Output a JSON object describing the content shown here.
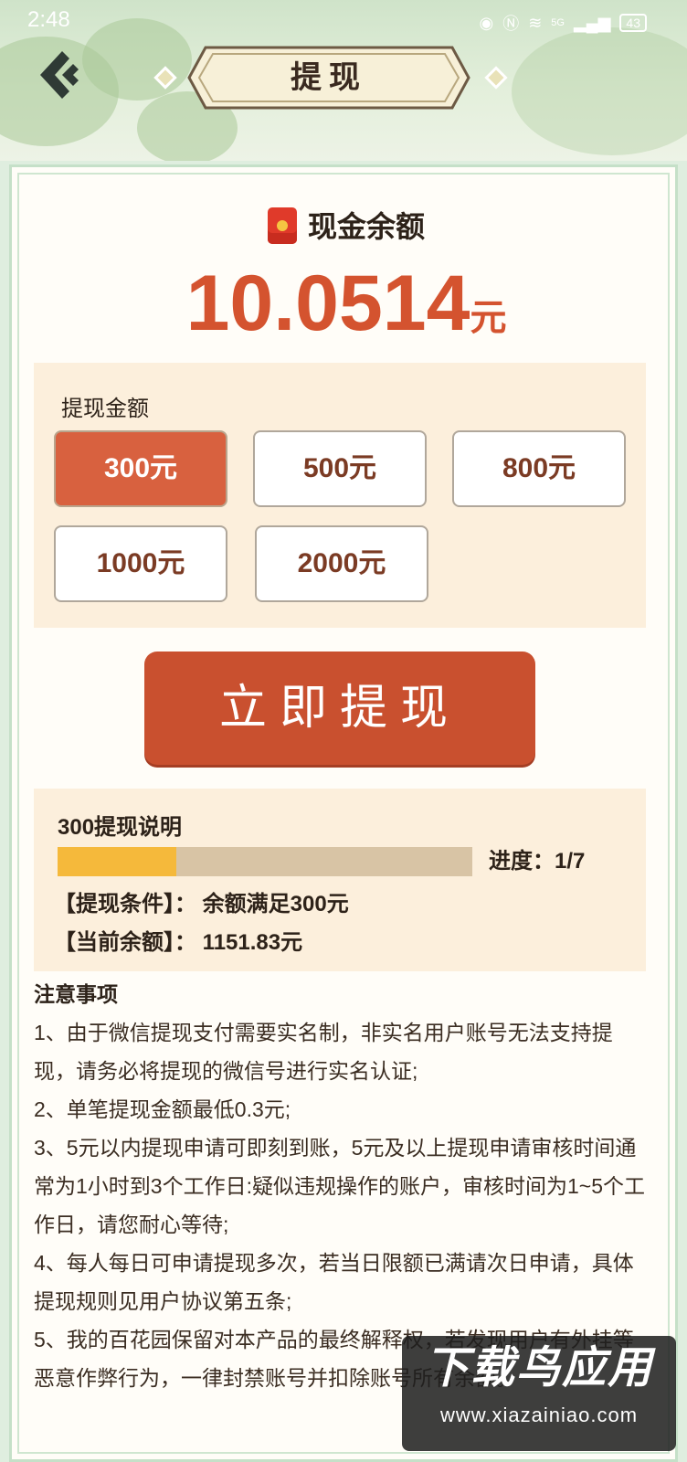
{
  "status_bar": {
    "time": "2:48",
    "signal": "5G",
    "battery": "43"
  },
  "header": {
    "title": "提现",
    "back_icon": "back-arrow-icon"
  },
  "balance": {
    "label": "现金余额",
    "amount": "10.0514",
    "unit": "元"
  },
  "amount_panel": {
    "title": "提现金额",
    "options": [
      {
        "label": "300元",
        "selected": true
      },
      {
        "label": "500元",
        "selected": false
      },
      {
        "label": "800元",
        "selected": false
      },
      {
        "label": "1000元",
        "selected": false
      },
      {
        "label": "2000元",
        "selected": false
      }
    ]
  },
  "withdraw_button": "立即提现",
  "explanation": {
    "title": "300提现说明",
    "progress_label": "进度：1/7",
    "progress_fraction": 0.2857,
    "condition": "【提现条件】：  余额满足300元",
    "current_balance": "【当前余额】：  1151.83元"
  },
  "notes": {
    "title": "注意事项",
    "items": [
      "1、由于微信提现支付需要实名制，非实名用户账号无法支持提现，请务必将提现的微信号进行实名认证;",
      "2、单笔提现金额最低0.3元;",
      "3、5元以内提现申请可即刻到账，5元及以上提现申请审核时间通常为1小时到3个工作日:疑似违规操作的账户，审核时间为1~5个工作日，请您耐心等待;",
      "4、每人每日可申请提现多次，若当日限额已满请次日申请，具体提现规则见用户协议第五条;",
      "5、我的百花园保留对本产品的最终解释权，若发现用户有外挂等恶意作弊行为，一律封禁账号并扣除账号所有余额。"
    ]
  },
  "watermark": {
    "text": "下载鸟应用",
    "url": "www.xiazainiao.com"
  },
  "colors": {
    "accent": "#d4532f",
    "button": "#c9502f",
    "panel": "#fcefdc",
    "progress": "#f5b93b"
  }
}
